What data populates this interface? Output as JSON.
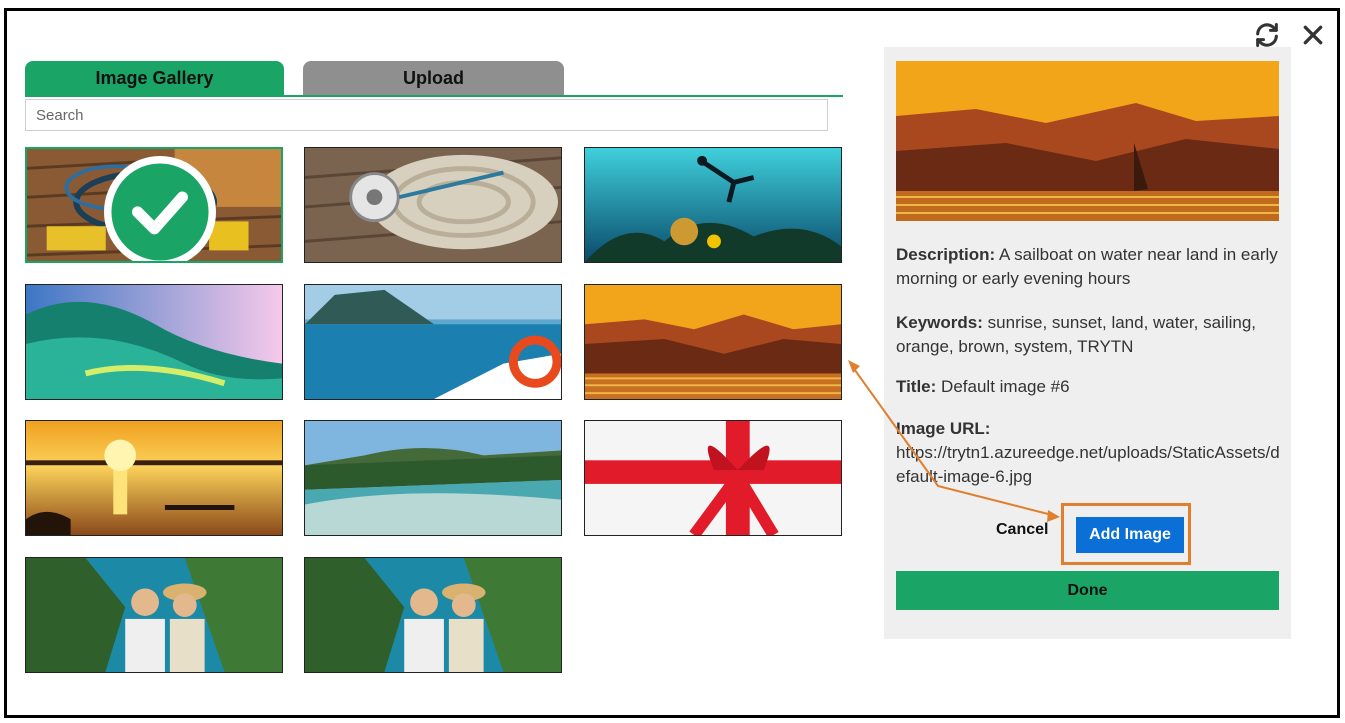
{
  "tabs": {
    "gallery": "Image Gallery",
    "upload": "Upload"
  },
  "search": {
    "placeholder": "Search",
    "value": ""
  },
  "icons": {
    "refresh": "refresh-icon",
    "close": "close-icon",
    "check": "check-icon"
  },
  "colors": {
    "accent_green": "#1aa567",
    "button_blue": "#0a6fd6",
    "highlight_orange": "#e07f2d",
    "tab_inactive": "#8f8f8f"
  },
  "gallery": {
    "images": [
      {
        "subject": "scuba gear",
        "selected": true
      },
      {
        "subject": "rope and pulley",
        "selected": false
      },
      {
        "subject": "underwater diver",
        "selected": false
      },
      {
        "subject": "ocean wave",
        "selected": false
      },
      {
        "subject": "boat bow",
        "selected": false
      },
      {
        "subject": "sailboat sunset",
        "selected": false
      },
      {
        "subject": "kayak sunset",
        "selected": false
      },
      {
        "subject": "beach coastline",
        "selected": false
      },
      {
        "subject": "red ribbon gift",
        "selected": false
      },
      {
        "subject": "couple on cliff",
        "selected": false
      },
      {
        "subject": "couple on cliff",
        "selected": false
      }
    ]
  },
  "details": {
    "description_label": "Description:",
    "description": "A sailboat on water near land in early morning or early evening hours",
    "keywords_label": "Keywords:",
    "keywords": "sunrise, sunset, land, water, sailing, orange, brown, system, TRYTN",
    "title_label": "Title:",
    "title": "Default image #6",
    "url_label": "Image URL:",
    "url": "https://trytn1.azureedge.net/uploads/StaticAssets/default-image-6.jpg"
  },
  "actions": {
    "cancel": "Cancel",
    "add_image": "Add Image",
    "done": "Done"
  }
}
